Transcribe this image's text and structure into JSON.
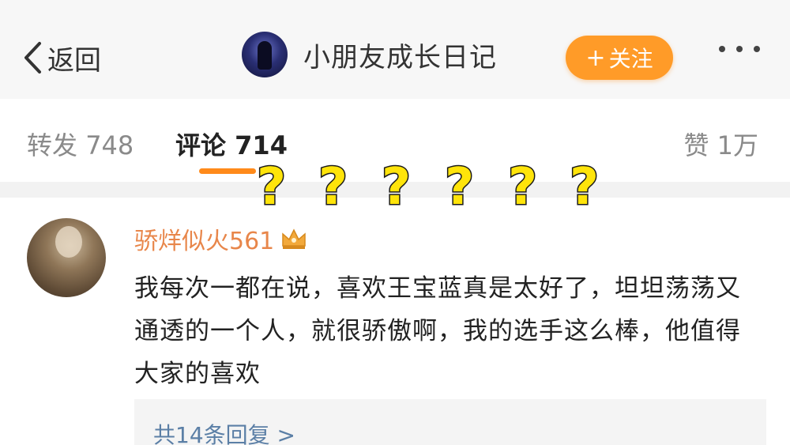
{
  "header": {
    "back_label": "返回",
    "account_name": "小朋友成长日记",
    "follow_label": "关注",
    "follow_plus": "+",
    "accent_color": "#ff9b28"
  },
  "tabs": {
    "repost_label": "转发",
    "repost_count": "748",
    "comment_label": "评论",
    "comment_count": "714",
    "like_label": "赞",
    "like_count": "1万"
  },
  "overlay": {
    "question_marks": [
      "?",
      "?",
      "?",
      "?",
      "?",
      "?"
    ],
    "color": "#ffe40a"
  },
  "comment": {
    "username": "骄烊似火561",
    "badge_icon": "crown-icon",
    "text": "我每次一都在说，喜欢王宝蓝真是太好了，坦坦荡荡又通透的一个人，就很骄傲啊，我的选手这么棒，他值得大家的喜欢",
    "replies_label": "共14条回复 >"
  }
}
